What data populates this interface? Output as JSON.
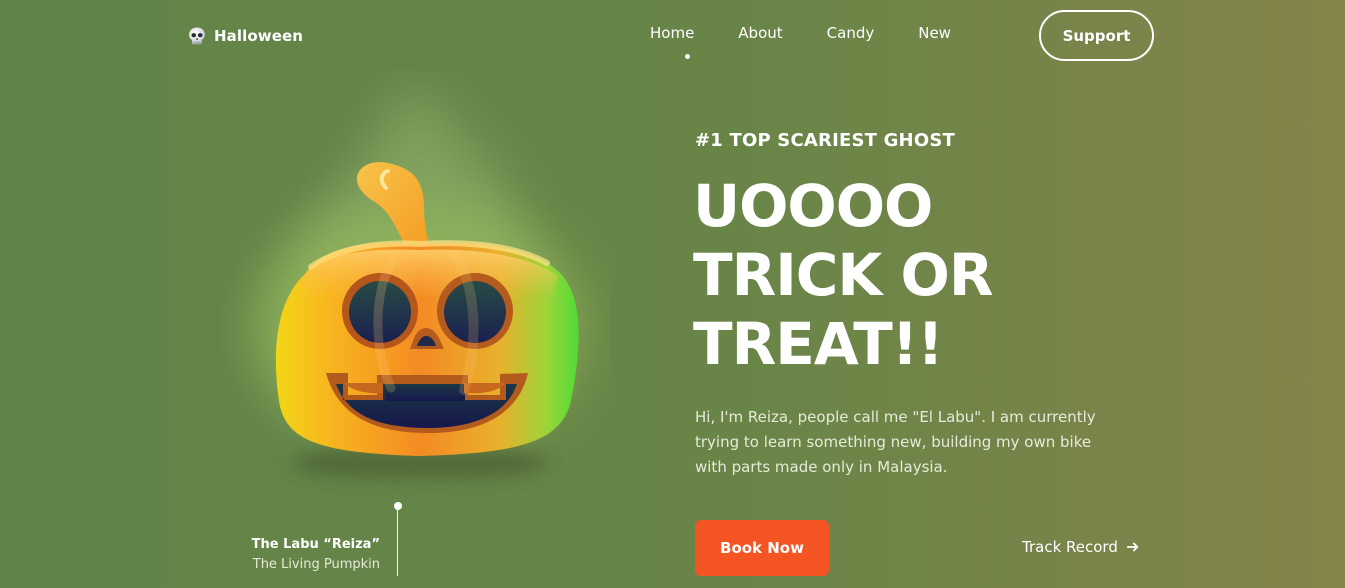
{
  "brand": {
    "name": "Halloween",
    "icon": "skull-icon"
  },
  "nav": {
    "items": [
      {
        "label": "Home",
        "active": true
      },
      {
        "label": "About",
        "active": false
      },
      {
        "label": "Candy",
        "active": false
      },
      {
        "label": "New",
        "active": false
      }
    ],
    "support_label": "Support"
  },
  "hero": {
    "eyebrow": "#1 TOP SCARIEST GHOST",
    "headline_lines": [
      "UOOOO",
      "TRICK OR",
      "TREAT!!"
    ],
    "description": "Hi, I'm Reiza, people call me \"El Labu\". I am currently trying to learn something new, building my own bike with parts made only in Malaysia.",
    "primary_button": "Book Now",
    "secondary_link": "Track Record",
    "secondary_icon": "arrow-right-icon"
  },
  "pumpkin": {
    "icon": "pumpkin-icon",
    "title": "The Labu “Reiza”",
    "subtitle": "The Living Pumpkin"
  },
  "colors": {
    "background_start": "#628449",
    "background_end": "#85844b",
    "primary_button": "#f55423",
    "text": "#ffffff"
  }
}
